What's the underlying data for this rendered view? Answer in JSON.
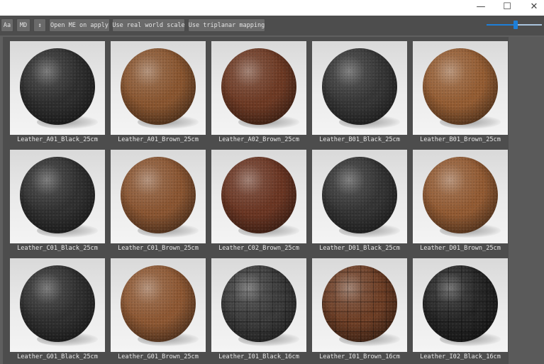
{
  "window": {
    "controls": [
      {
        "name": "minimize-button",
        "glyph": "—"
      },
      {
        "name": "maximize-button",
        "glyph": "☐"
      },
      {
        "name": "close-button",
        "glyph": "✕"
      }
    ]
  },
  "toolbar": {
    "buttons": [
      {
        "name": "aa-button",
        "label": "Aa"
      },
      {
        "name": "md-button",
        "label": "MD"
      },
      {
        "name": "sort-button",
        "label": "↕"
      },
      {
        "name": "open-me-on-apply-button",
        "label": "Open ME on apply"
      },
      {
        "name": "use-real-world-scale-button",
        "label": "Use real world scale"
      },
      {
        "name": "use-triplanar-mapping-button",
        "label": "Use triplanar mapping"
      }
    ],
    "thumbnail_size_fraction": 0.53
  },
  "materials": [
    {
      "name": "Leather_A01_Black_25cm",
      "color": "#2e2e2e",
      "style": "plain"
    },
    {
      "name": "Leather_A01_Brown_25cm",
      "color": "#8a5630",
      "style": "plain"
    },
    {
      "name": "Leather_A02_Brown_25cm",
      "color": "#6e3a24",
      "style": "plain"
    },
    {
      "name": "Leather_B01_Black_25cm",
      "color": "#363636",
      "style": "plain"
    },
    {
      "name": "Leather_B01_Brown_25cm",
      "color": "#955d33",
      "style": "plain"
    },
    {
      "name": "Leather_C01_Black_25cm",
      "color": "#303030",
      "style": "plain"
    },
    {
      "name": "Leather_C01_Brown_25cm",
      "color": "#8b5632",
      "style": "plain"
    },
    {
      "name": "Leather_C02_Brown_25cm",
      "color": "#6b3623",
      "style": "plain"
    },
    {
      "name": "Leather_D01_Black_25cm",
      "color": "#343434",
      "style": "plain"
    },
    {
      "name": "Leather_D01_Brown_25cm",
      "color": "#935b33",
      "style": "plain"
    },
    {
      "name": "Leather_G01_Black_25cm",
      "color": "#2f2f2f",
      "style": "plain"
    },
    {
      "name": "Leather_G01_Brown_25cm",
      "color": "#8e5833",
      "style": "plain"
    },
    {
      "name": "Leather_I01_Black_16cm",
      "color": "#3c3c3c",
      "style": "tiles"
    },
    {
      "name": "Leather_I01_Brown_16cm",
      "color": "#6f3f26",
      "style": "tiles"
    },
    {
      "name": "Leather_I02_Black_16cm",
      "color": "#262626",
      "style": "tiles"
    }
  ]
}
